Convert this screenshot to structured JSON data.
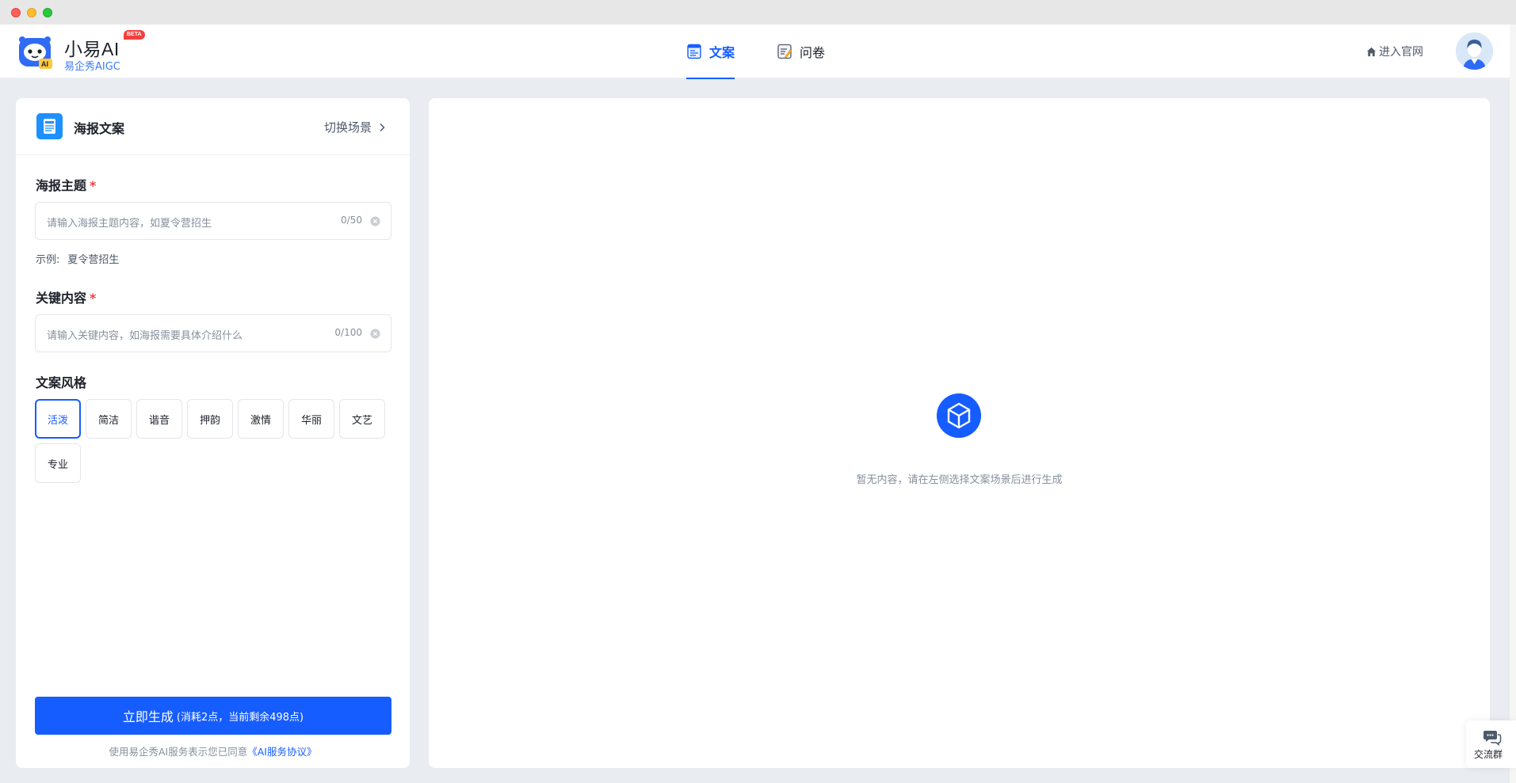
{
  "header": {
    "brand_name": "小易AI",
    "beta": "BETA",
    "brand_sub": "易企秀AIGC",
    "tabs": [
      {
        "label": "文案",
        "icon": "document-icon",
        "active": true
      },
      {
        "label": "问卷",
        "icon": "survey-icon",
        "active": false
      }
    ],
    "enter_site": "进入官网"
  },
  "left_panel": {
    "scene_title": "海报文案",
    "switch_scene": "切换场景",
    "fields": {
      "theme": {
        "label": "海报主题",
        "required_mark": "*",
        "placeholder": "请输入海报主题内容，如夏令营招生",
        "counter": "0/50",
        "example_label": "示例:",
        "example_value": "夏令营招生"
      },
      "key_content": {
        "label": "关键内容",
        "required_mark": "*",
        "placeholder": "请输入关键内容，如海报需要具体介绍什么",
        "counter": "0/100"
      }
    },
    "style": {
      "label": "文案风格",
      "options": [
        "活泼",
        "简洁",
        "谐音",
        "押韵",
        "激情",
        "华丽",
        "文艺",
        "专业"
      ],
      "selected": "活泼"
    },
    "generate_button": {
      "main": "立即生成",
      "sub": "(消耗2点，当前剩余498点)"
    },
    "agreement": {
      "text": "使用易企秀AI服务表示您已同意",
      "link": "《AI服务协议》"
    }
  },
  "right_panel": {
    "empty_text": "暂无内容，请在左侧选择文案场景后进行生成"
  },
  "floating": {
    "community_label": "交流群"
  },
  "colors": {
    "primary": "#165dff",
    "required": "#f53f3f",
    "background": "#e9ecf1"
  }
}
